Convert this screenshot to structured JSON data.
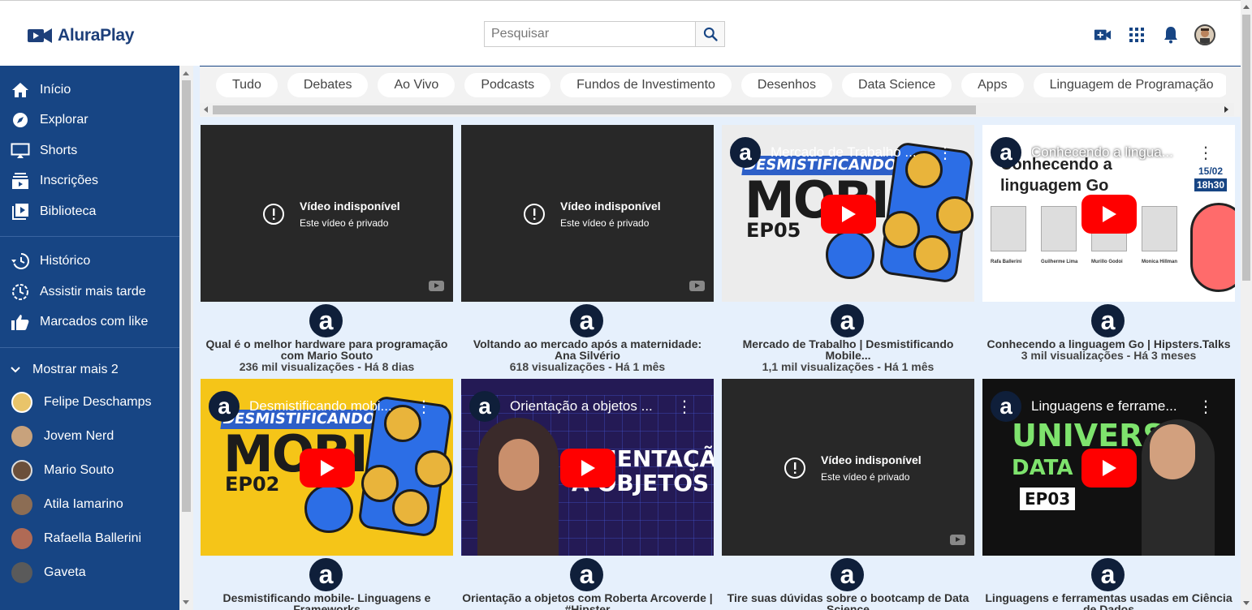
{
  "app": {
    "logo_text": "AluraPlay"
  },
  "search": {
    "placeholder": "Pesquisar"
  },
  "header_icons": [
    "video-camera-add-icon",
    "apps-grid-icon",
    "bell-icon",
    "user-avatar"
  ],
  "sidebar": {
    "main_items": [
      {
        "label": "Início",
        "icon": "home-icon"
      },
      {
        "label": "Explorar",
        "icon": "compass-icon"
      },
      {
        "label": "Shorts",
        "icon": "shorts-icon"
      },
      {
        "label": "Inscrições",
        "icon": "subscriptions-icon"
      },
      {
        "label": "Biblioteca",
        "icon": "library-icon"
      }
    ],
    "secondary_items": [
      {
        "label": "Histórico",
        "icon": "history-icon"
      },
      {
        "label": "Assistir mais tarde",
        "icon": "clock-icon"
      },
      {
        "label": "Marcados com like",
        "icon": "thumbs-up-icon"
      }
    ],
    "show_more_label": "Mostrar mais 2",
    "channels": [
      {
        "label": "Felipe Deschamps",
        "color": "#e9c46a"
      },
      {
        "label": "Jovem Nerd",
        "color": "#c8a27c"
      },
      {
        "label": "Mario Souto",
        "color": "#6b4f3a"
      },
      {
        "label": "Atila Iamarino",
        "color": "#8c6d54"
      },
      {
        "label": "Rafaella Ballerini",
        "color": "#b06a55"
      },
      {
        "label": "Gaveta",
        "color": "#5a5a5a"
      }
    ]
  },
  "chips": [
    "Tudo",
    "Debates",
    "Ao Vivo",
    "Podcasts",
    "Fundos de Investimento",
    "Desenhos",
    "Data Science",
    "Apps",
    "Linguagem de Programação"
  ],
  "unavailable": {
    "title": "Vídeo indisponível",
    "subtitle": "Este vídeo é privado"
  },
  "videos": [
    {
      "title": "Qual é o melhor hardware para programação com Mario Souto",
      "meta": "236 mil visualizações - Há 8 dias",
      "overlay": ""
    },
    {
      "title": "Voltando ao mercado após a maternidade: Ana Silvério",
      "meta": "618 visualizações - Há 1 mês",
      "overlay": ""
    },
    {
      "title": "Mercado de Trabalho | Desmistificando Mobile...",
      "meta": "1,1 mil visualizações - Há 1 mês",
      "overlay": "Mercado de Trabalho ..."
    },
    {
      "title": "Conhecendo a linguagem Go | Hipsters.Talks",
      "meta": "3 mil visualizações - Há 3 meses",
      "overlay": "Conhecendo a lingua..."
    },
    {
      "title": "Desmistificando mobile- Linguagens e Frameworks",
      "meta": "",
      "overlay": "Desmistificando mobi..."
    },
    {
      "title": "Orientação a objetos com Roberta Arcoverde | #Hipster",
      "meta": "",
      "overlay": "Orientação a objetos ..."
    },
    {
      "title": "Tire suas dúvidas sobre o bootcamp de Data Science",
      "meta": "",
      "overlay": ""
    },
    {
      "title": "Linguagens e ferramentas usadas em Ciência de Dados",
      "meta": "",
      "overlay": "Linguagens e ferrame..."
    }
  ],
  "thumb_text": {
    "desmistificando": "DESMISTIFICANDO",
    "mobile": "MOBILE",
    "ep05": "EP05",
    "ep02": "EP02",
    "go_title_1": "Conhecendo a",
    "go_title_2": "linguagem Go",
    "go_date": "15/02",
    "go_time": "18h30",
    "go_people": [
      "Rafa Ballerini",
      "Guilherme Lima",
      "Murillo Godoi",
      "Monica Hillman"
    ],
    "oo_text_1": "ORIENTAÇÃO",
    "oo_text_2": "A OBJETOS",
    "ds_text_1": "UNIVERSO",
    "ds_text_2": "DATA SC",
    "ds_ep": "EP03"
  },
  "channel_letter": "a"
}
